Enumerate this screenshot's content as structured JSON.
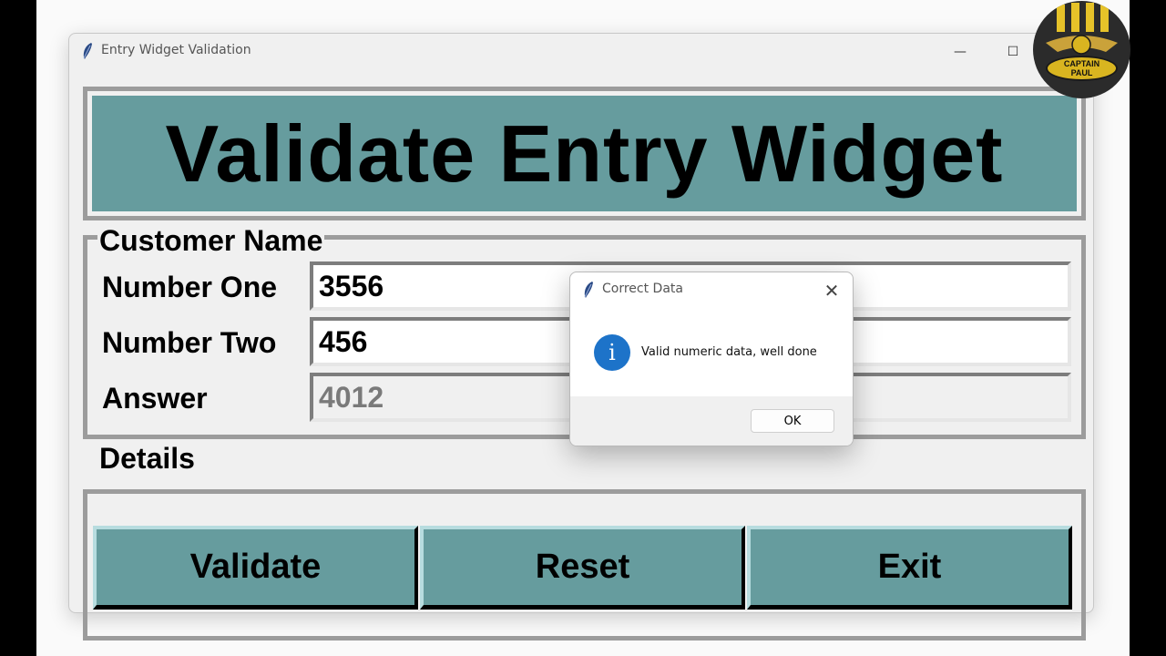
{
  "window": {
    "title": "Entry Widget Validation",
    "minimize_glyph": "—",
    "maximize_glyph": "☐"
  },
  "app": {
    "heading": "Validate Entry Widget",
    "customer_frame": {
      "label": "Customer Name",
      "rows": [
        {
          "label": "Number One",
          "value": "3556",
          "state": "normal"
        },
        {
          "label": "Number Two",
          "value": "456",
          "state": "normal"
        },
        {
          "label": "Answer",
          "value": "4012",
          "state": "disabled"
        }
      ]
    },
    "details_frame": {
      "label": "Details",
      "buttons": [
        {
          "label": "Validate"
        },
        {
          "label": "Reset"
        },
        {
          "label": "Exit"
        }
      ]
    }
  },
  "dialog": {
    "title": "Correct Data",
    "icon": "info-icon",
    "icon_glyph": "i",
    "message": "Valid numeric data, well done",
    "ok_label": "OK",
    "close_glyph": "✕"
  },
  "logo": {
    "line1": "CAPTAIN",
    "line2": "PAUL"
  },
  "colors": {
    "teal": "#669c9e",
    "frame_border": "#9c9c9c",
    "info_blue": "#1d73c9"
  }
}
